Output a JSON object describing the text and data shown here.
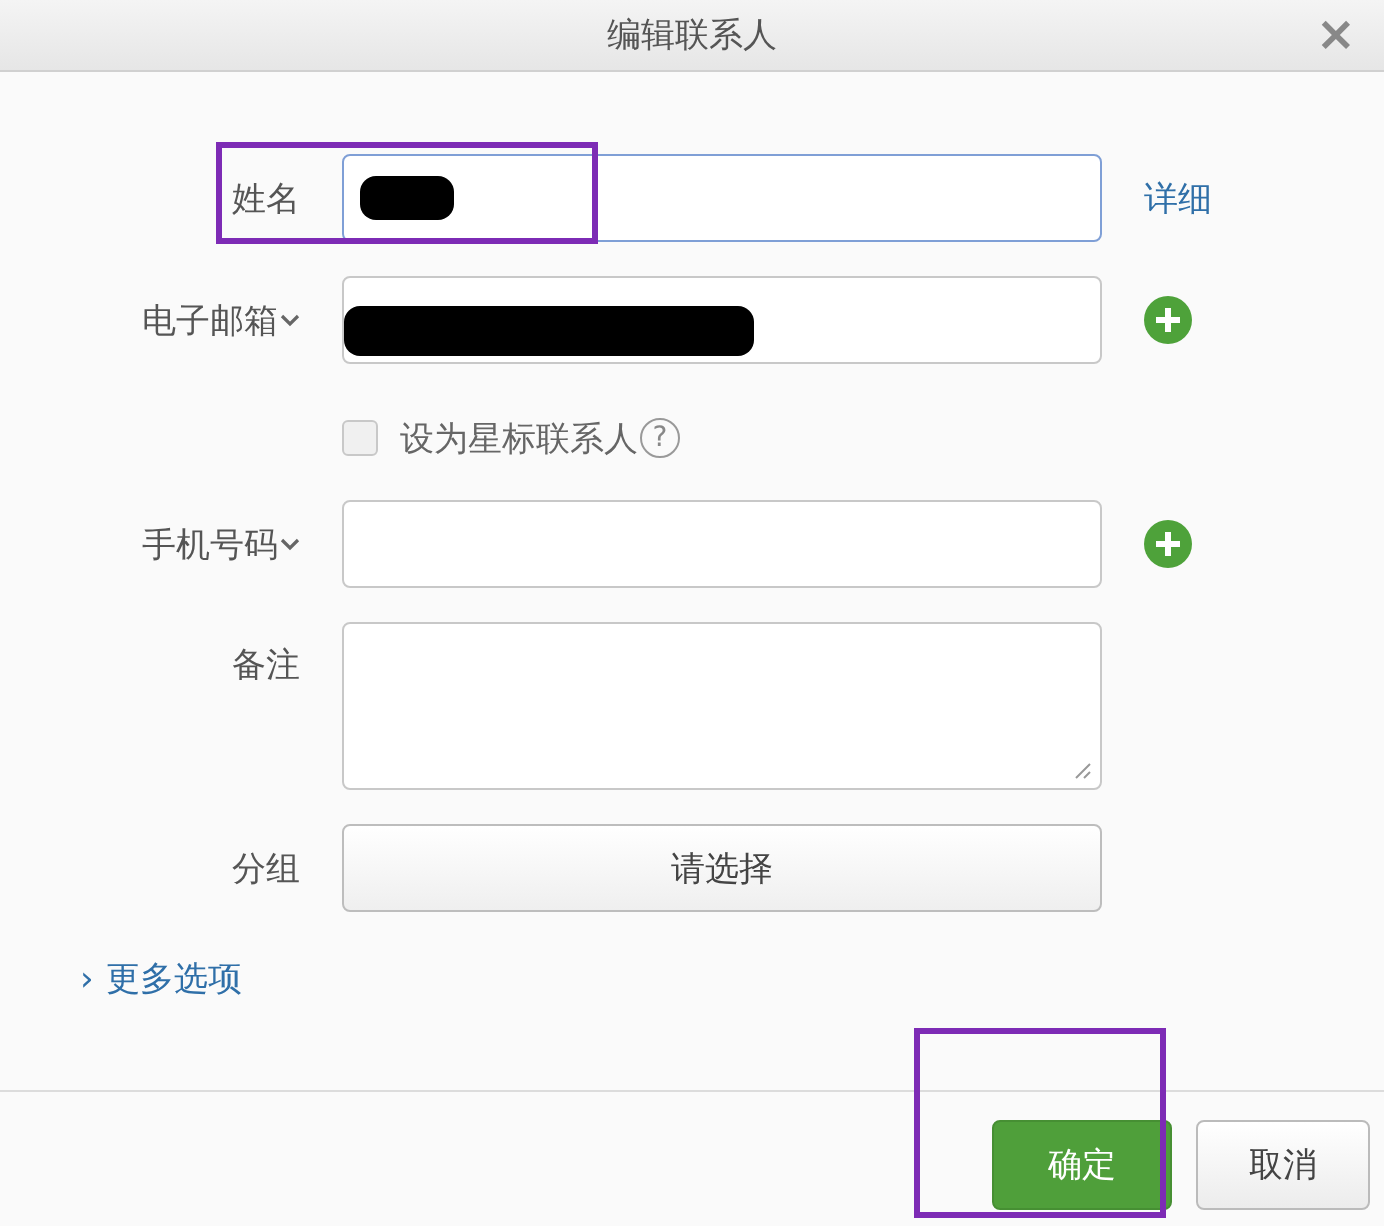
{
  "window": {
    "title": "编辑联系人",
    "close": "×"
  },
  "rows": [
    {
      "kind": "text",
      "label": "姓名",
      "has_dropdown": false,
      "focused": true,
      "redacted": true,
      "highlighted": true,
      "extra": {
        "kind": "link",
        "text": "详细"
      }
    },
    {
      "kind": "text",
      "label": "电子邮箱",
      "has_dropdown": true,
      "focused": false,
      "redacted": true,
      "highlighted": false,
      "extra": {
        "kind": "add"
      }
    },
    {
      "kind": "checkbox",
      "text": "设为星标联系人",
      "checked": false,
      "help": "?"
    },
    {
      "kind": "text",
      "label": "手机号码",
      "has_dropdown": true,
      "focused": false,
      "redacted": false,
      "highlighted": false,
      "extra": {
        "kind": "add"
      }
    },
    {
      "kind": "textarea",
      "label": "备注"
    },
    {
      "kind": "select",
      "label": "分组",
      "placeholder": "请选择"
    }
  ],
  "more_options": {
    "arrow": "›",
    "text": "更多选项"
  },
  "buttons": [
    {
      "kind": "primary",
      "label": "确定",
      "highlighted": true
    },
    {
      "kind": "secondary",
      "label": "取消",
      "highlighted": false
    }
  ]
}
